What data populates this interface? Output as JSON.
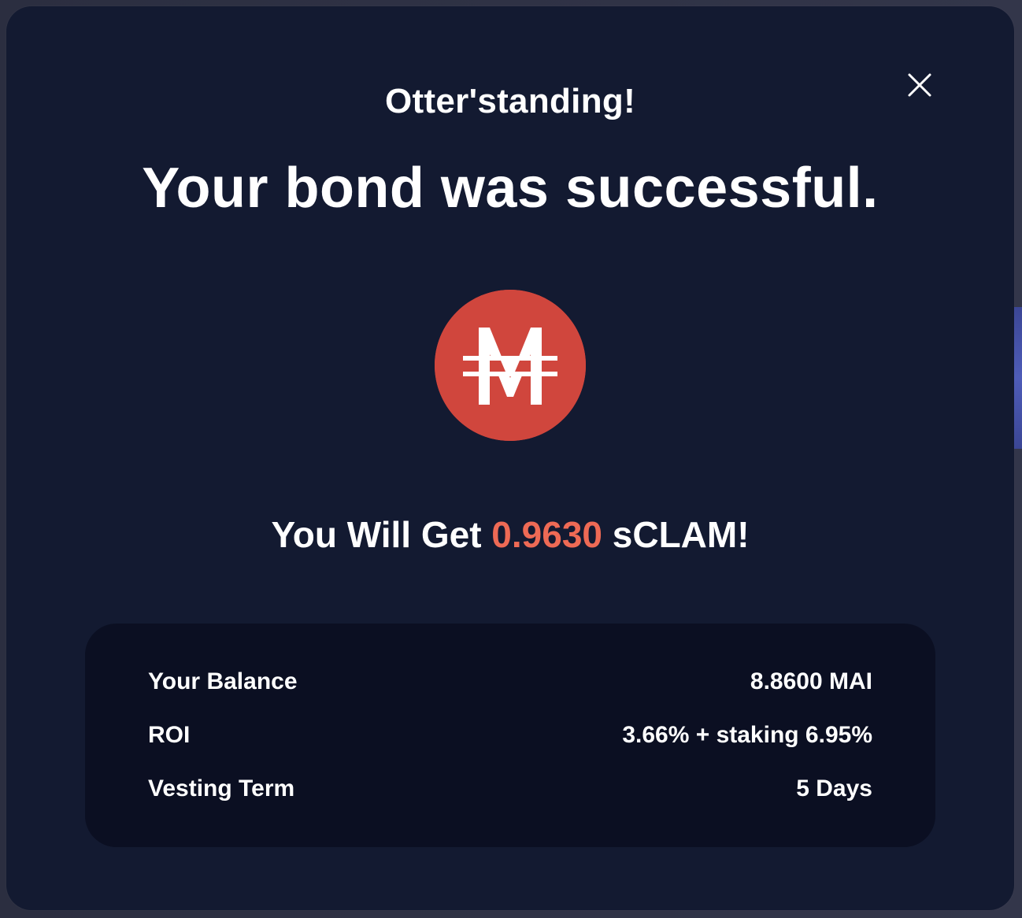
{
  "modal": {
    "subtitle": "Otter'standing!",
    "headline": "Your bond was successful.",
    "token_icon": "mai-token-icon",
    "reward": {
      "prefix": "You Will Get",
      "amount": "0.9630",
      "suffix": "sCLAM!"
    },
    "details": [
      {
        "label": "Your Balance",
        "value": "8.8600 MAI"
      },
      {
        "label": "ROI",
        "value": "3.66% + staking 6.95%"
      },
      {
        "label": "Vesting Term",
        "value": "5 Days"
      }
    ]
  },
  "colors": {
    "modal_background": "#131a31",
    "details_background": "#0b0f22",
    "accent": "#ee6a55",
    "token_red": "#d0463d",
    "text": "#ffffff"
  }
}
